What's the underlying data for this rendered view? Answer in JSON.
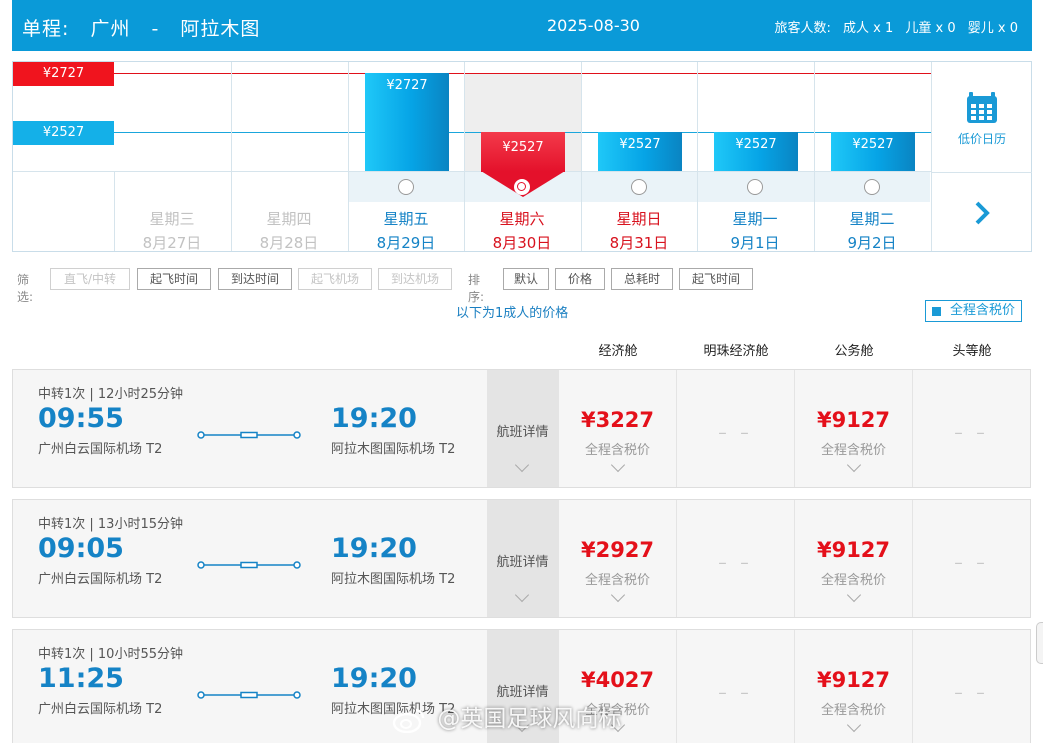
{
  "header": {
    "trip_type": "单程:",
    "from": "广州",
    "sep": "-",
    "to": "阿拉木图",
    "date": "2025-08-30",
    "pax_label": "旅客人数:",
    "adult": "成人 x 1",
    "child": "儿童 x 0",
    "infant": "婴儿 x 0"
  },
  "calendar": {
    "ref_high": "¥2727",
    "ref_low": "¥2527",
    "low_calendar": "低价日历",
    "days": [
      {
        "weekday": "星期三",
        "date": "8月27日",
        "price": "",
        "state": "disabled"
      },
      {
        "weekday": "星期四",
        "date": "8月28日",
        "price": "",
        "state": "disabled"
      },
      {
        "weekday": "星期五",
        "date": "8月29日",
        "price": "¥2727",
        "state": "normal"
      },
      {
        "weekday": "星期六",
        "date": "8月30日",
        "price": "¥2527",
        "state": "selected"
      },
      {
        "weekday": "星期日",
        "date": "8月31日",
        "price": "¥2527",
        "state": "weekend"
      },
      {
        "weekday": "星期一",
        "date": "9月1日",
        "price": "¥2527",
        "state": "normal"
      },
      {
        "weekday": "星期二",
        "date": "9月2日",
        "price": "¥2527",
        "state": "normal"
      }
    ]
  },
  "filters": {
    "filter_label": "筛选:",
    "filter_buttons": [
      "直飞/中转",
      "起飞时间",
      "到达时间",
      "起飞机场",
      "到达机场"
    ],
    "filter_disabled": [
      true,
      false,
      false,
      true,
      true
    ],
    "sort_label": "排序:",
    "sort_buttons": [
      "默认",
      "价格",
      "总耗时",
      "起飞时间"
    ]
  },
  "note": "以下为1成人的价格",
  "tax_toggle": "全程含税价",
  "cabins": [
    "经济舱",
    "明珠经济舱",
    "公务舱",
    "头等舱"
  ],
  "flights": [
    {
      "stops": "中转1次 | 12小时25分钟",
      "dep_time": "09:55",
      "dep_airport": "广州白云国际机场 T2",
      "arr_time": "19:20",
      "arr_airport": "阿拉木图国际机场 T2",
      "detail": "航班详情",
      "prices": [
        "¥3227",
        "– –",
        "¥9127",
        "– –"
      ],
      "tax_note": "全程含税价"
    },
    {
      "stops": "中转1次 | 13小时15分钟",
      "dep_time": "09:05",
      "dep_airport": "广州白云国际机场 T2",
      "arr_time": "19:20",
      "arr_airport": "阿拉木图国际机场 T2",
      "detail": "航班详情",
      "prices": [
        "¥2927",
        "– –",
        "¥9127",
        "– –"
      ],
      "tax_note": "全程含税价"
    },
    {
      "stops": "中转1次 | 10小时55分钟",
      "dep_time": "11:25",
      "dep_airport": "广州白云国际机场 T2",
      "arr_time": "19:20",
      "arr_airport": "阿拉木图国际机场 T2",
      "detail": "航班详情",
      "prices": [
        "¥4027",
        "– –",
        "¥9127",
        "– –"
      ],
      "tax_note": "全程含税价"
    }
  ],
  "watermark": "@英国足球风向标",
  "colors": {
    "brand": "#0a9ad8",
    "price_red": "#e4101a",
    "selected": "#e4112b"
  }
}
